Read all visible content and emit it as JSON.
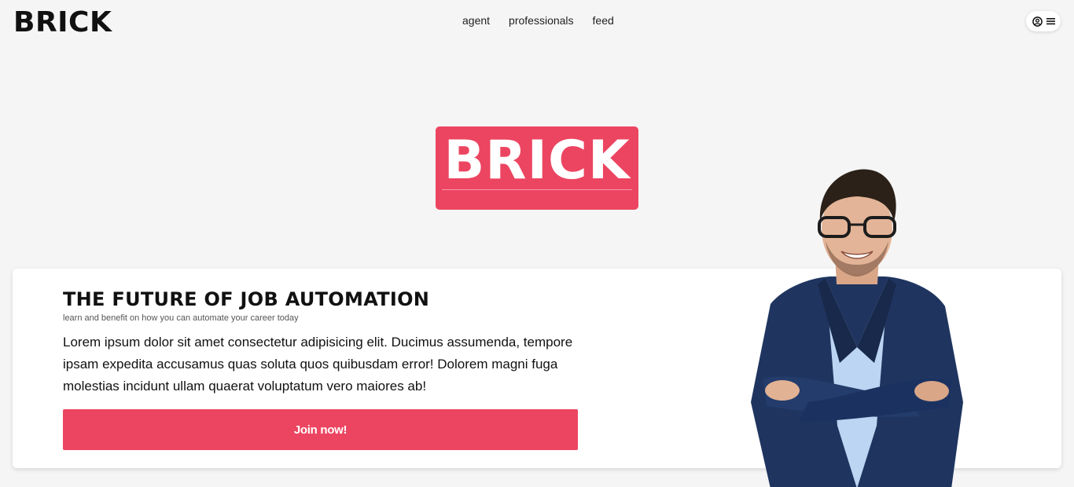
{
  "header": {
    "logo": "BRICK",
    "nav": [
      "agent",
      "professionals",
      "feed"
    ],
    "user_menu_icons": [
      "user-circle-icon",
      "hamburger-icon"
    ]
  },
  "hero": {
    "logo": "BRICK",
    "accent": "#ec4561"
  },
  "card": {
    "title": "THE FUTURE OF JOB AUTOMATION",
    "subtitle": "learn and benefit on how you can automate your career today",
    "body": "Lorem ipsum dolor sit amet consectetur adipisicing elit. Ducimus assumenda, tempore ipsam expedita accusamus quas soluta quos quibusdam error! Dolorem magni fuga molestias incidunt ullam quaerat voluptatum vero maiores ab!",
    "button": "Join now!"
  }
}
